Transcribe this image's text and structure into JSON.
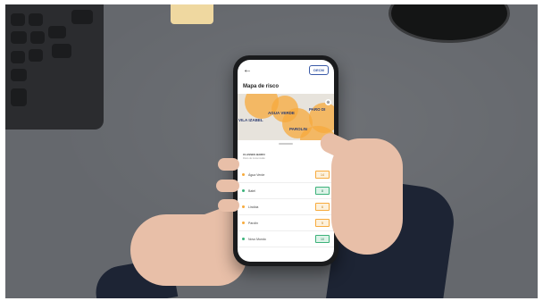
{
  "app": {
    "screen_title": "Mapa de risco",
    "logo_text": "DECM",
    "back_icon": "back-arrow-icon"
  },
  "map": {
    "labels": [
      "AGUA VERDE",
      "PARO DI",
      "VILA IZABEL",
      "PAROLIN"
    ],
    "zone_color": "#f7aa3c"
  },
  "section": {
    "title": "CLASSES BAIRO",
    "subtitle": "Risco de transmissão"
  },
  "neighborhoods": [
    {
      "name": "Água Verde",
      "value": "14",
      "color": "#f7aa3c"
    },
    {
      "name": "Batel",
      "value": "8",
      "color": "#3cb27a"
    },
    {
      "name": "Lindóia",
      "value": "6",
      "color": "#f7aa3c"
    },
    {
      "name": "Parolin",
      "value": "5",
      "color": "#f7aa3c"
    },
    {
      "name": "Novo Mundo",
      "value": "10",
      "color": "#3cb27a"
    }
  ],
  "colors": {
    "risk_high": "#f7aa3c",
    "risk_low": "#3cb27a",
    "brand": "#3a5aa8"
  }
}
